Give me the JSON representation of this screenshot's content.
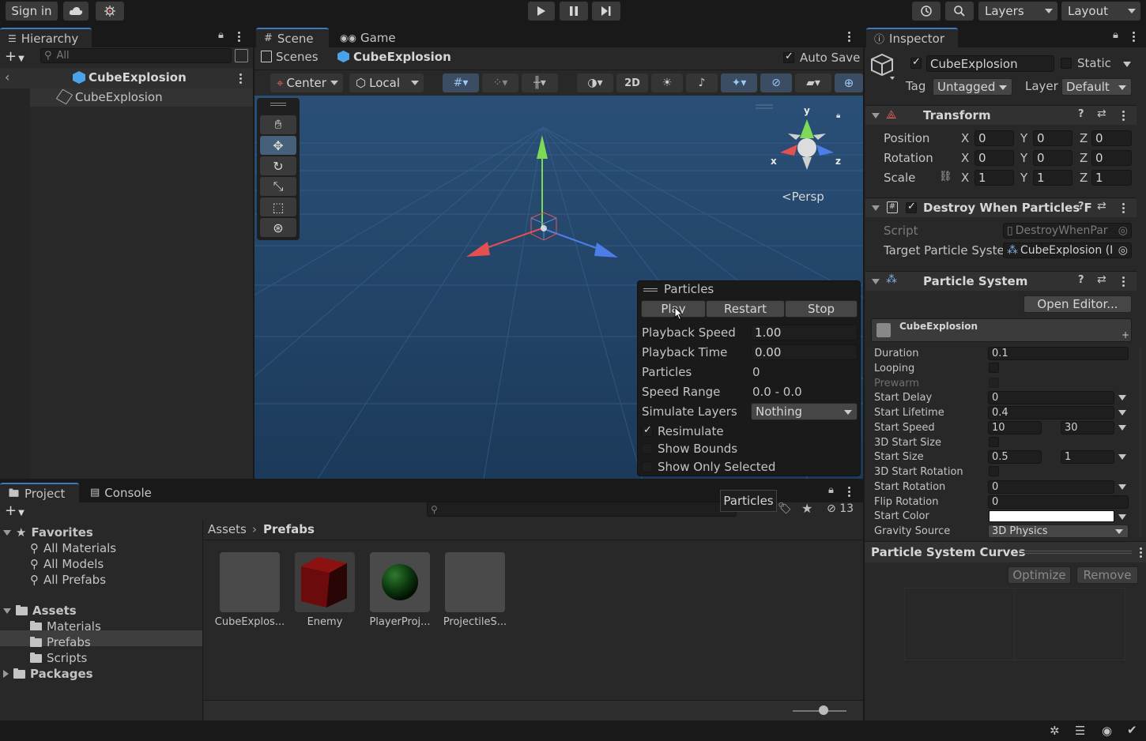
{
  "topbar": {
    "sign_in": "Sign in",
    "layers": "Layers",
    "layout": "Layout"
  },
  "hierarchy": {
    "tab": "Hierarchy",
    "search_placeholder": "All",
    "prefab_title": "CubeExplosion",
    "item": "CubeExplosion"
  },
  "scene": {
    "tab_scene": "Scene",
    "tab_game": "Game",
    "breadcrumb_root": "Scenes",
    "breadcrumb_current": "CubeExplosion",
    "auto_save": "Auto Save",
    "pivot": "Center",
    "space": "Local",
    "mode_2d": "2D",
    "persp": "<Persp",
    "gizmo_x": "x",
    "gizmo_y": "y",
    "gizmo_z": "z"
  },
  "particles_overlay": {
    "title": "Particles",
    "play": "Play",
    "restart": "Restart",
    "stop": "Stop",
    "rows": [
      {
        "label": "Playback Speed",
        "value": "1.00"
      },
      {
        "label": "Playback Time",
        "value": "0.00"
      },
      {
        "label": "Particles",
        "value": "0"
      },
      {
        "label": "Speed Range",
        "value": "0.0 - 0.0"
      },
      {
        "label": "Simulate Layers",
        "value": "Nothing"
      }
    ],
    "resimulate": "Resimulate",
    "show_bounds": "Show Bounds",
    "show_only_selected": "Show Only Selected",
    "tooltip": "Particles"
  },
  "project": {
    "tab_project": "Project",
    "tab_console": "Console",
    "hidden_count": "13",
    "favorites": "Favorites",
    "fav_items": [
      "All Materials",
      "All Models",
      "All Prefabs"
    ],
    "assets": "Assets",
    "asset_folders": [
      "Materials",
      "Prefabs",
      "Scripts"
    ],
    "packages": "Packages",
    "breadcrumb_root": "Assets",
    "breadcrumb_current": "Prefabs",
    "files": [
      {
        "name": "CubeExplos...",
        "color": "#4a4a4a"
      },
      {
        "name": "Enemy",
        "color": "#7a0d0d"
      },
      {
        "name": "PlayerProj...",
        "color": "#0f3b10"
      },
      {
        "name": "ProjectileS...",
        "color": "#4a4a4a"
      }
    ]
  },
  "inspector": {
    "tab": "Inspector",
    "object_name": "CubeExplosion",
    "static": "Static",
    "tag_label": "Tag",
    "tag_value": "Untagged",
    "layer_label": "Layer",
    "layer_value": "Default",
    "transform": {
      "title": "Transform",
      "position": "Position",
      "rotation": "Rotation",
      "scale": "Scale",
      "pos": [
        "0",
        "0",
        "0"
      ],
      "rot": [
        "0",
        "0",
        "0"
      ],
      "scl": [
        "1",
        "1",
        "1"
      ],
      "axis": [
        "X",
        "Y",
        "Z"
      ]
    },
    "destroy": {
      "title": "Destroy When Particles F",
      "script_label": "Script",
      "script_value": "DestroyWhenPar",
      "target_label": "Target Particle Syste",
      "target_value": "CubeExplosion (I"
    },
    "particle_system": {
      "title": "Particle System",
      "open_editor": "Open Editor...",
      "module_title": "CubeExplosion",
      "duration_label": "Duration",
      "duration": "0.1",
      "looping_label": "Looping",
      "prewarm_label": "Prewarm",
      "start_delay_label": "Start Delay",
      "start_delay": "0",
      "start_lifetime_label": "Start Lifetime",
      "start_lifetime": "0.4",
      "start_speed_label": "Start Speed",
      "start_speed_min": "10",
      "start_speed_max": "30",
      "start_size_3d_label": "3D Start Size",
      "start_size_label": "Start Size",
      "start_size_min": "0.5",
      "start_size_max": "1",
      "start_rotation_3d_label": "3D Start Rotation",
      "start_rotation_label": "Start Rotation",
      "start_rotation": "0",
      "flip_rotation_label": "Flip Rotation",
      "flip_rotation": "0",
      "start_color_label": "Start Color",
      "start_color": "#ffffff",
      "gravity_source_label": "Gravity Source",
      "gravity_source": "3D Physics"
    },
    "curves": {
      "title": "Particle System Curves",
      "optimize": "Optimize",
      "remove": "Remove"
    }
  },
  "colors": {
    "accent": "#3a79bb",
    "selection": "#2c5d87",
    "scene_bg": "#23486c"
  }
}
